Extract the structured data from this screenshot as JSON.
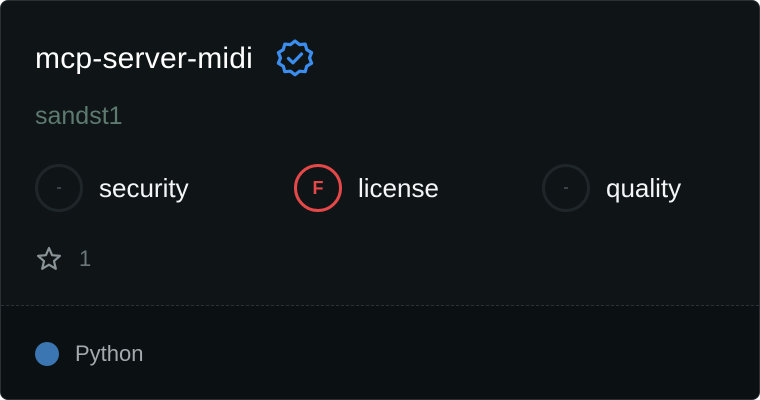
{
  "server": {
    "name": "mcp-server-midi",
    "owner": "sandst1",
    "verified_icon": "verified-badge-icon"
  },
  "scores": [
    {
      "grade": "-",
      "label": "security",
      "status": "unrated"
    },
    {
      "grade": "F",
      "label": "license",
      "status": "fail"
    },
    {
      "grade": "-",
      "label": "quality",
      "status": "unrated"
    }
  ],
  "stars": {
    "icon": "star-icon",
    "count": "1"
  },
  "footer": {
    "language": "Python",
    "language_color": "#3b76b3"
  },
  "colors": {
    "background": "#0f1416",
    "verified": "#3b8ef0",
    "fail": "#e54848",
    "owner_text": "#5d7a70"
  }
}
